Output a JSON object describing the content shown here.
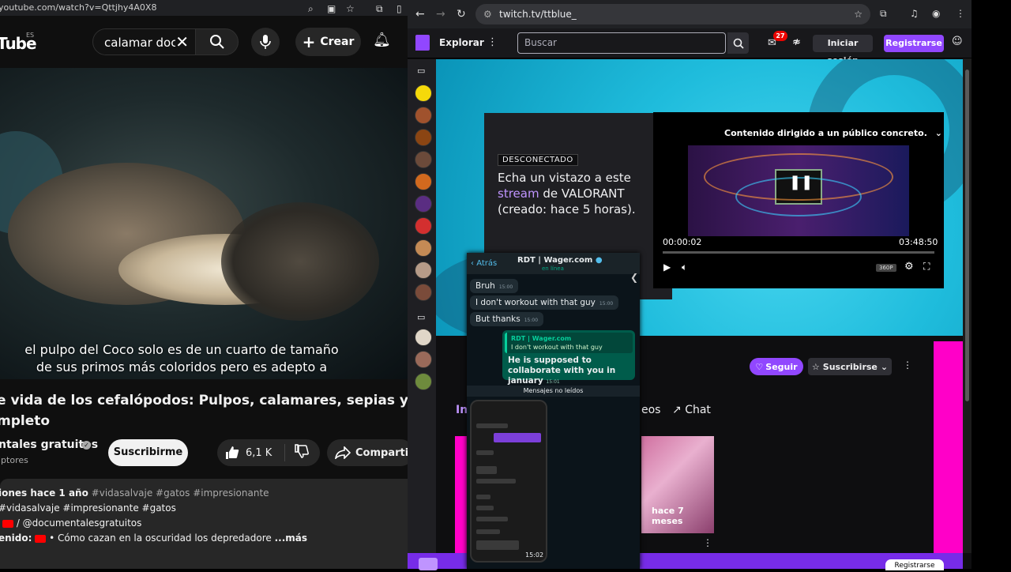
{
  "youtube": {
    "url": "youtube.com/watch?v=Qttjhy4A0X8",
    "logo": "Tube",
    "region": "ES",
    "search_value": "calamar docu",
    "create_label": "Crear",
    "caption_line1": "el pulpo del Coco solo es de un cuarto de tamaño",
    "caption_line2": "de sus primos más coloridos pero es adepto a",
    "title_line1": "e vida de los cefalópodos: Pulpos, calamares, sepias y nautilos",
    "title_line2": "mpleto",
    "channel": "ntales gratuitos",
    "channel_sub": "iptores",
    "subscribe_label": "Suscribirme",
    "likes": "6,1 K",
    "share_label": "Compartir",
    "desc_line1_a": "iones  hace 1 año",
    "desc_line1_b": "#vidasalvaje #gatos #impresionante",
    "desc_line2": "#vidasalvaje #impresionante #gatos",
    "desc_line3": "/ @documentalesgratuitos",
    "desc_line4_a": "enido:",
    "desc_line4_b": "• Cómo cazan en la oscuridad los depredadore",
    "desc_more": "...más"
  },
  "twitch": {
    "url": "twitch.tv/ttblue_",
    "explore_label": "Explorar",
    "search_placeholder": "Buscar",
    "notif_count": "27",
    "login_label": "Iniciar sesión",
    "register_label": "Registrarse",
    "offline_badge": "DESCONECTADO",
    "offline_text_1": "Echa un vistazo a este",
    "offline_text_hl": "stream",
    "offline_text_2": "de VALORANT (creado: hace 5 horas).",
    "player_notice": "Contenido dirigido a un público concreto.",
    "player_time_current": "00:00:02",
    "player_time_total": "03:48:50",
    "player_quality": "360P",
    "follow_label": "Seguir",
    "subscribe_label": "Suscribirse",
    "tab_home": "In",
    "tab_videos": "eos",
    "tab_chat": "Chat",
    "card_time": "hace 7 meses",
    "bottom_register": "Registrarse"
  },
  "chat": {
    "back_label": "Atrás",
    "contact": "RDT | Wager.com",
    "status": "en línea",
    "msg1": "Bruh",
    "msg1_time": "15:00",
    "msg2": "I don't workout with that guy",
    "msg2_time": "15:00",
    "msg3": "But thanks",
    "msg3_time": "15:00",
    "quote_name": "RDT | Wager.com",
    "quote_text": "I don't workout with that guy",
    "out_text": "He is supposed to collaborate with you in january",
    "out_time": "15:01",
    "unread_label": "Mensajes no leídos",
    "shot_time": "15:02"
  },
  "colors": {
    "twitch_purple": "#9147ff",
    "youtube_bg": "#0f0f0f",
    "whatsapp_green": "#005c4b"
  }
}
